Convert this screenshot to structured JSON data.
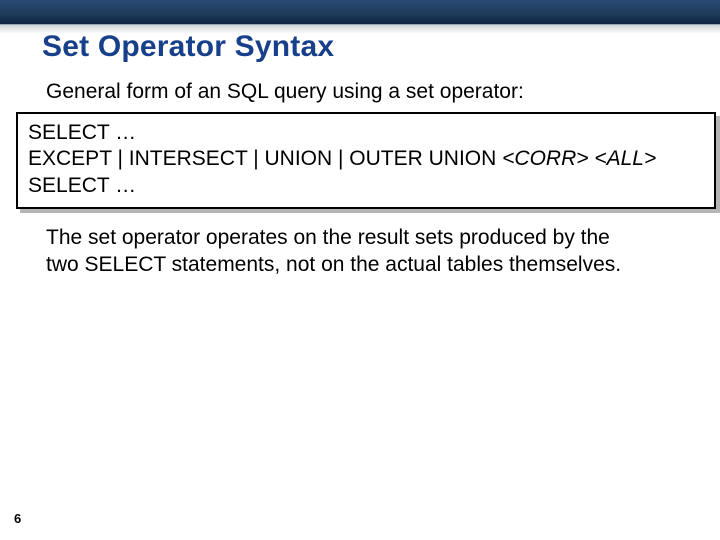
{
  "title": "Set Operator Syntax",
  "subtitle": "General form of an SQL query using a set operator:",
  "code": {
    "line1": "SELECT …",
    "line2a": "EXCEPT | INTERSECT | UNION | OUTER UNION ",
    "line2b": "<CORR> <ALL>",
    "line3": "SELECT …"
  },
  "body": "The set operator operates on the result sets produced by the two SELECT statements, not on the actual tables themselves.",
  "page_number": "6"
}
